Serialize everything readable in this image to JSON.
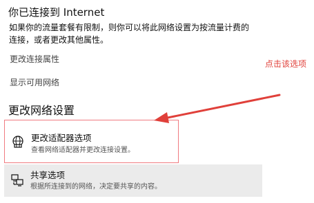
{
  "status": {
    "title": "你已连接到 Internet",
    "description": "如果你的流量套餐有限制，则你可以将此网络设置为按流量计费的连接，或者更改其他属性。"
  },
  "links": {
    "change_connection_properties": "更改连接属性",
    "show_available_networks": "显示可用网络"
  },
  "annotation": {
    "text": "点击该选项",
    "color": "#e0403a"
  },
  "section": {
    "heading": "更改网络设置"
  },
  "options": {
    "adapter": {
      "icon": "network-adapter-icon",
      "title": "更改适配器选项",
      "description": "查看网络适配器并更改连接设置。"
    },
    "sharing": {
      "icon": "sharing-icon",
      "title": "共享选项",
      "description": "根据所连接到的网络，决定要共享的内容。"
    }
  }
}
